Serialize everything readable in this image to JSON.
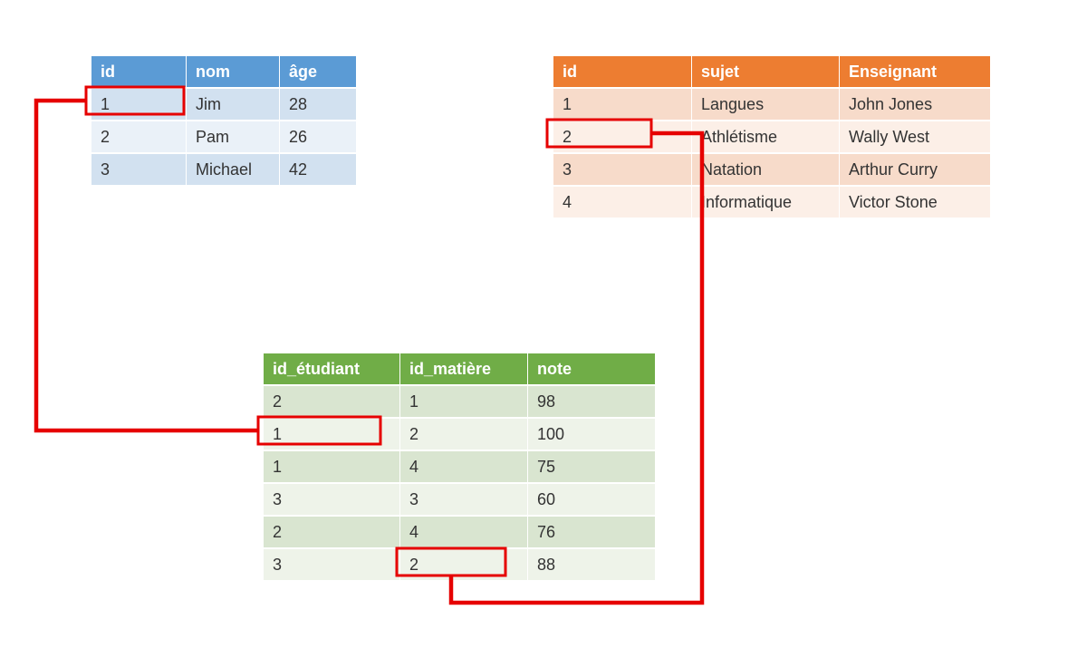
{
  "students": {
    "headers": [
      "id",
      "nom",
      "âge"
    ],
    "rows": [
      [
        "1",
        "Jim",
        "28"
      ],
      [
        "2",
        "Pam",
        "26"
      ],
      [
        "3",
        "Michael",
        "42"
      ]
    ]
  },
  "subjects": {
    "headers": [
      "id",
      "sujet",
      "Enseignant"
    ],
    "rows": [
      [
        "1",
        "Langues",
        "John Jones"
      ],
      [
        "2",
        "Athlétisme",
        "Wally West"
      ],
      [
        "3",
        "Natation",
        "Arthur Curry"
      ],
      [
        "4",
        "Informatique",
        "Victor Stone"
      ]
    ]
  },
  "grades": {
    "headers": [
      "id_étudiant",
      "id_matière",
      "note"
    ],
    "rows": [
      [
        "2",
        "1",
        "98"
      ],
      [
        "1",
        "2",
        "100"
      ],
      [
        "1",
        "4",
        "75"
      ],
      [
        "3",
        "3",
        "60"
      ],
      [
        "2",
        "4",
        "76"
      ],
      [
        "3",
        "2",
        "88"
      ]
    ]
  }
}
